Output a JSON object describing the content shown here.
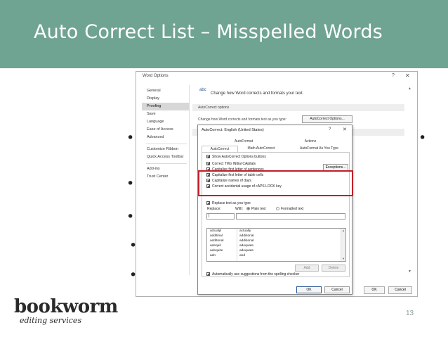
{
  "slide": {
    "title": "Auto Correct List – Misspelled Words",
    "page_number": "13",
    "header_color": "#6fa392"
  },
  "word_options": {
    "title": "Word Options",
    "help": "?",
    "close": "✕",
    "nav": [
      "General",
      "Display",
      "Proofing",
      "Save",
      "Language",
      "Ease of Access",
      "Advanced",
      "Customize Ribbon",
      "Quick Access Toolbar",
      "Add-ins",
      "Trust Center"
    ],
    "selected_nav": "Proofing",
    "header_icon": "abc",
    "header_text": "Change how Word corrects and formats your text.",
    "section_title": "AutoCorrect options",
    "change_text": "Change how Word corrects and formats text as you type:",
    "autocorrect_button": "AutoCorrect Options...",
    "ok": "OK",
    "cancel": "Cancel"
  },
  "autocorrect_dialog": {
    "title": "AutoCorrect: English (United States)",
    "help": "?",
    "close": "✕",
    "tabs_row1": [
      "AutoFormat",
      "Actions"
    ],
    "tabs_row2": [
      "AutoCorrect",
      "Math AutoCorrect",
      "AutoFormat As You Type"
    ],
    "active_tab": "AutoCorrect",
    "checkboxes": [
      {
        "label": "Show AutoCorrect Options buttons",
        "checked": true
      },
      {
        "label": "Correct TWo INitial CApitals",
        "checked": true
      },
      {
        "label": "Capitalize first letter of sentences",
        "checked": true
      },
      {
        "label": "Capitalize first letter of table cells",
        "checked": true
      },
      {
        "label": "Capitalize names of days",
        "checked": true
      },
      {
        "label": "Correct accidental usage of cAPS LOCK key",
        "checked": true
      }
    ],
    "exceptions_button": "Exceptions...",
    "replace_checkbox": "Replace text as you type",
    "replace_label": "Replace:",
    "with_label": "With:",
    "plain_text": "Plain text",
    "formatted_text": "Formatted text",
    "list": [
      [
        "actualyl",
        "actually"
      ],
      [
        "additinal",
        "additional"
      ],
      [
        "additonal",
        "additional"
      ],
      [
        "adequit",
        "adequate"
      ],
      [
        "adequite",
        "adequate"
      ],
      [
        "adn",
        "and"
      ]
    ],
    "add_button": "Add",
    "delete_button": "Delete",
    "suggestions_checkbox": "Automatically use suggestions from the spelling checker",
    "ok": "OK",
    "cancel": "Cancel",
    "highlight_color": "#c0202a"
  },
  "logo": {
    "main": "bookworm",
    "sub": "editing services"
  }
}
